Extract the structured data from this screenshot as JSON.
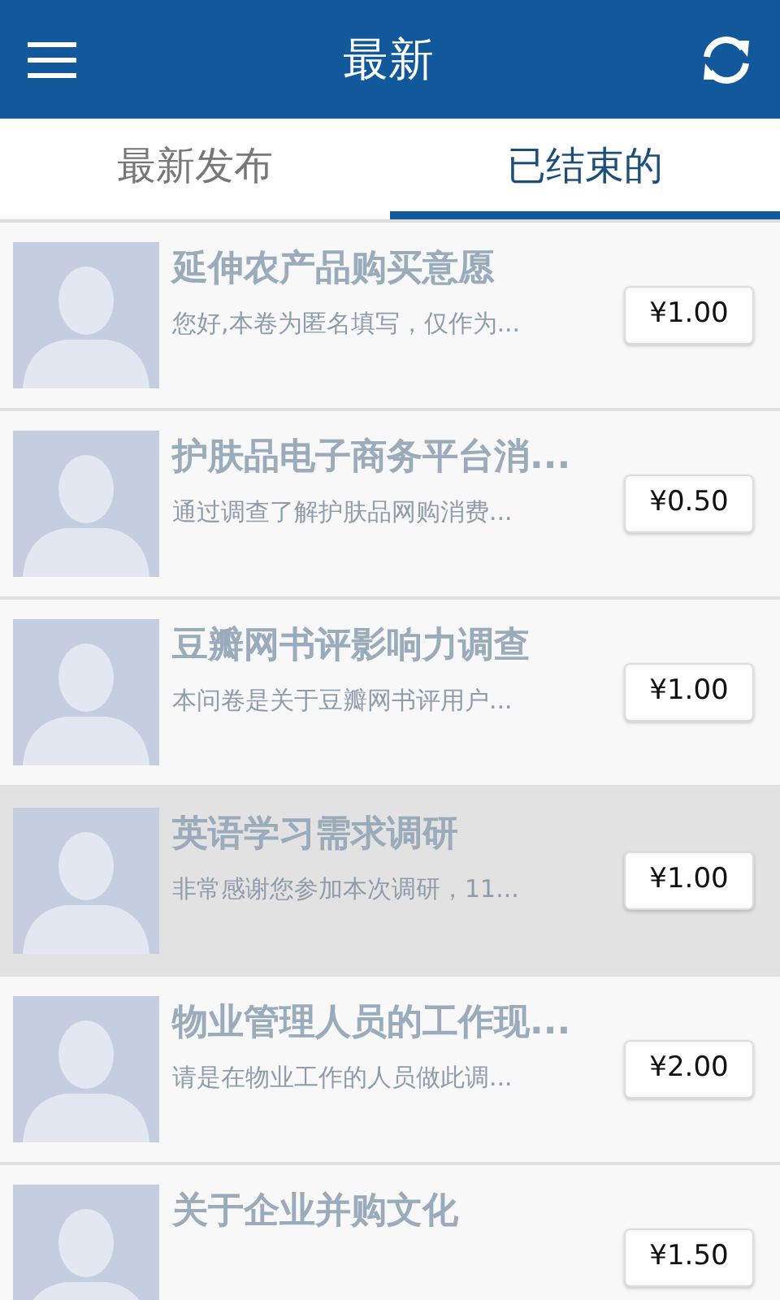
{
  "app_bar": {
    "title": "最新"
  },
  "tabs": [
    {
      "label": "最新发布",
      "selected": false
    },
    {
      "label": "已结束的",
      "selected": true
    }
  ],
  "surveys": [
    {
      "title": "延伸农产品购买意愿",
      "summary": "您好,本卷为匿名填写，仅作为...",
      "price": "¥1.00",
      "highlighted": false
    },
    {
      "title": "护肤品电子商务平台消...",
      "summary": "通过调查了解护肤品网购消费...",
      "price": "¥0.50",
      "highlighted": false
    },
    {
      "title": "豆瓣网书评影响力调查",
      "summary": "本问卷是关于豆瓣网书评用户...",
      "price": "¥1.00",
      "highlighted": false
    },
    {
      "title": "英语学习需求调研",
      "summary": "非常感谢您参加本次调研，11...",
      "price": "¥1.00",
      "highlighted": true
    },
    {
      "title": "物业管理人员的工作现...",
      "summary": "请是在物业工作的人员做此调...",
      "price": "¥2.00",
      "highlighted": false
    },
    {
      "title": "关于企业并购文化",
      "price": "¥1.50",
      "highlighted": false
    }
  ]
}
